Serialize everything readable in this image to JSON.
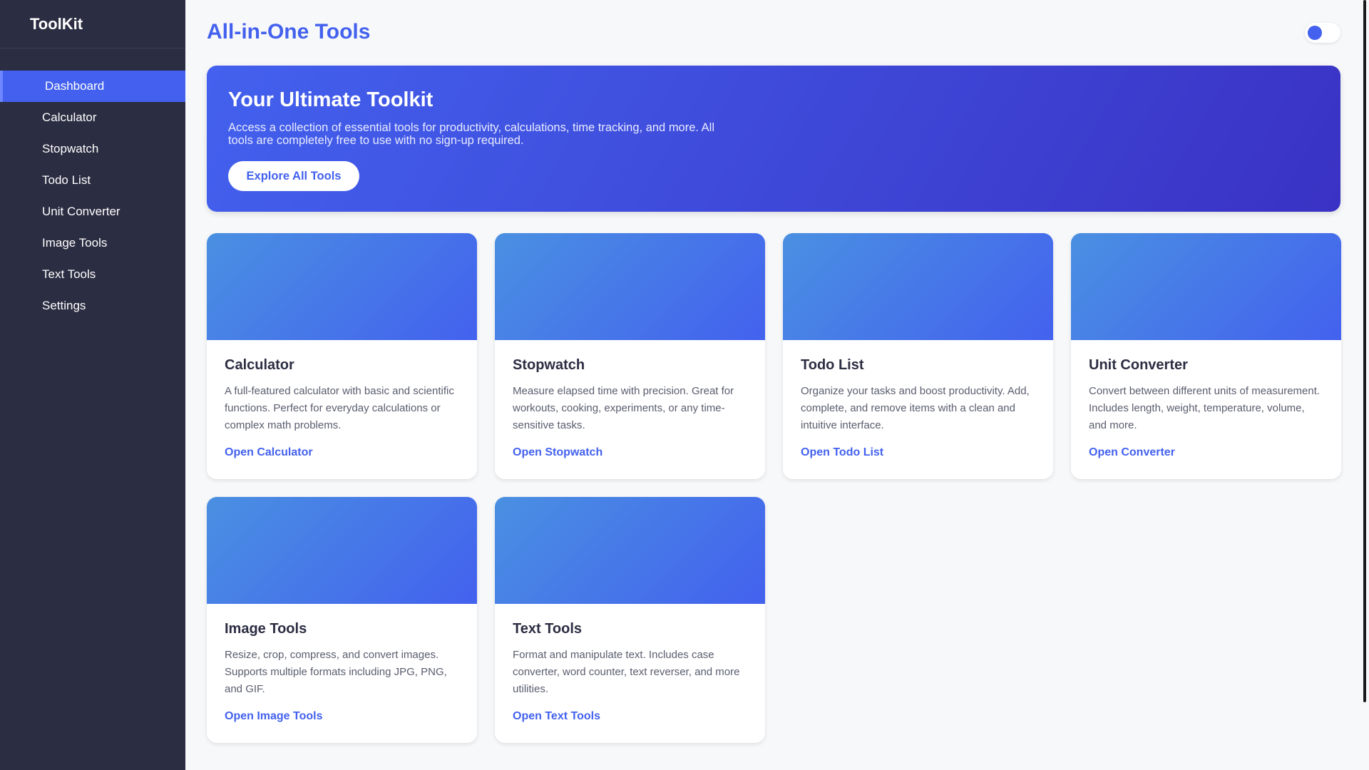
{
  "sidebar": {
    "brand": "ToolKit",
    "items": [
      {
        "label": "Dashboard",
        "active": true
      },
      {
        "label": "Calculator"
      },
      {
        "label": "Stopwatch"
      },
      {
        "label": "Todo List"
      },
      {
        "label": "Unit Converter"
      },
      {
        "label": "Image Tools"
      },
      {
        "label": "Text Tools"
      },
      {
        "label": "Settings"
      }
    ]
  },
  "header": {
    "title": "All-in-One Tools",
    "theme_toggle_icon": "toggle-icon"
  },
  "hero": {
    "title": "Your Ultimate Toolkit",
    "description": "Access a collection of essential tools for productivity, calculations, time tracking, and more. All tools are completely free to use with no sign-up required.",
    "button_label": "Explore All Tools"
  },
  "cards": [
    {
      "title": "Calculator",
      "description": "A full-featured calculator with basic and scientific functions. Perfect for everyday calculations or complex math problems.",
      "link": "Open Calculator"
    },
    {
      "title": "Stopwatch",
      "description": "Measure elapsed time with precision. Great for workouts, cooking, experiments, or any time-sensitive tasks.",
      "link": "Open Stopwatch"
    },
    {
      "title": "Todo List",
      "description": "Organize your tasks and boost productivity. Add, complete, and remove items with a clean and intuitive interface.",
      "link": "Open Todo List"
    },
    {
      "title": "Unit Converter",
      "description": "Convert between different units of measurement. Includes length, weight, temperature, volume, and more.",
      "link": "Open Converter"
    },
    {
      "title": "Image Tools",
      "description": "Resize, crop, compress, and convert images. Supports multiple formats including JPG, PNG, and GIF.",
      "link": "Open Image Tools"
    },
    {
      "title": "Text Tools",
      "description": "Format and manipulate text. Includes case converter, word counter, text reverser, and more utilities.",
      "link": "Open Text Tools"
    }
  ],
  "colors": {
    "accent": "#4361ee",
    "sidebar_bg": "#2b2d42",
    "page_bg": "#f7f8fa"
  }
}
